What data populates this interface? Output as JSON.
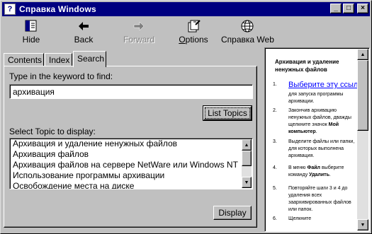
{
  "window": {
    "title": "Справка Windows",
    "icon": "help-book-icon"
  },
  "title_buttons": {
    "minimize": "_",
    "maximize": "□",
    "close": "×"
  },
  "toolbar": {
    "hide": "Hide",
    "back": "Back",
    "forward": "Forward",
    "options": "Options",
    "web": "Справка Web"
  },
  "tabs": [
    "Contents",
    "Index",
    "Search"
  ],
  "search": {
    "keyword_label": "Type in the keyword to find:",
    "keyword_value": "архивация",
    "list_topics_button": "List Topics",
    "select_label": "Select Topic to display:",
    "topics": [
      "Архивация и удаление ненужных файлов",
      "Архивация файлов",
      "Архивация файлов на сервере NetWare или Windows NT",
      "Использование программы архивации",
      "Освобождение места на диске"
    ],
    "display_button": "Display"
  },
  "help_page": {
    "title": "Архивация и удаление ненужных файлов",
    "steps": [
      {
        "num": "1.",
        "link": "Выберите эту ссылк",
        "text": "для запуска программы архивации."
      },
      {
        "num": "2.",
        "text": "Закончив архивацию ненужных файлов, дважды щелкните значок",
        "bold": "Мой компьютер",
        "tail": "."
      },
      {
        "num": "3.",
        "text": "Выделите файлы или папки, для которых выполнена архивация."
      },
      {
        "num": "4.",
        "pre": "В меню",
        "bold": "Файл",
        "text": "выберите команду",
        "bold2": "Удалить",
        "tail": "."
      },
      {
        "num": "5.",
        "text": "Повторяйте шаги 3 и 4 до удаления всех заархивированных файлов или папок."
      },
      {
        "num": "6.",
        "text": "Щелкните"
      }
    ]
  }
}
